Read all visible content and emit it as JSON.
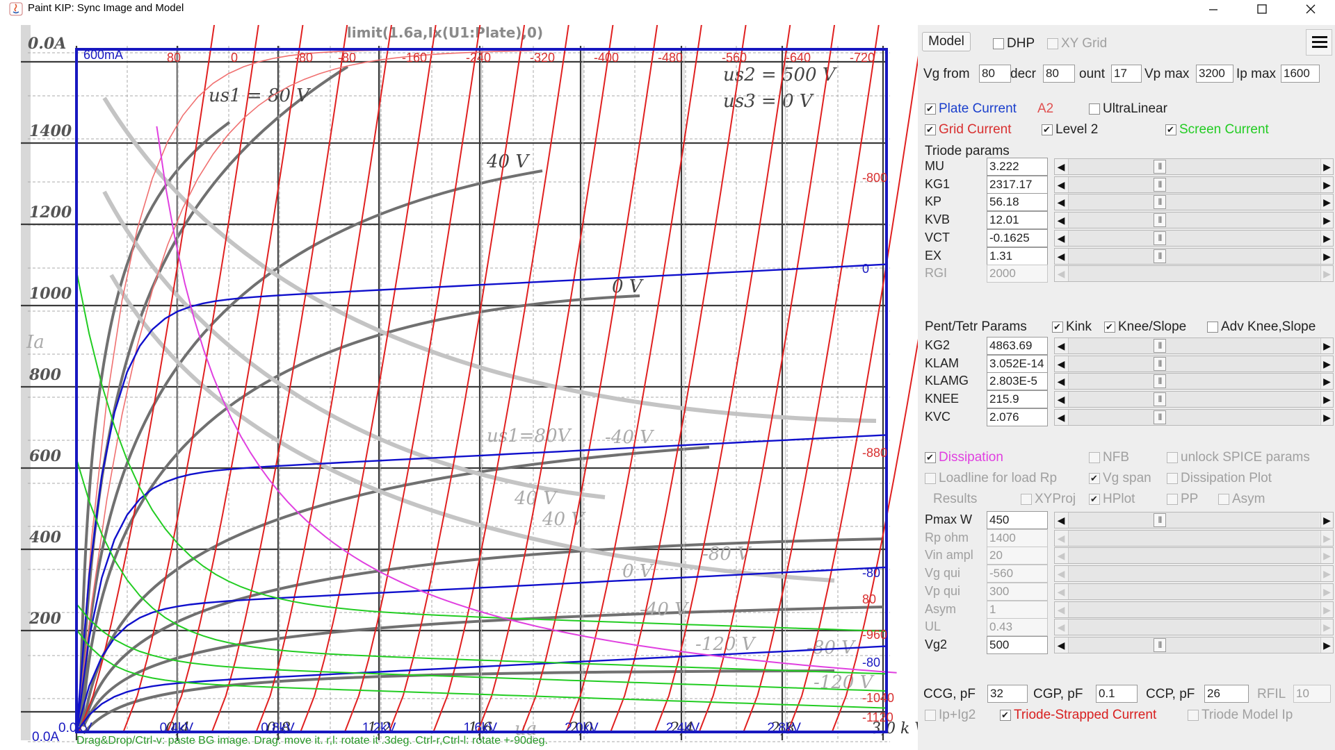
{
  "window": {
    "title": "Paint KIP: Sync Image and Model",
    "buttons": {
      "minimize": "minimize",
      "maximize": "maximize",
      "close": "close"
    }
  },
  "plot": {
    "chart_data": {
      "type": "line",
      "title": "limit(1.6a,Ix(U1:Plate),0)",
      "xlim": [
        0,
        3200
      ],
      "ylim": [
        0,
        1600
      ],
      "ip_scale_label": "600mA",
      "y_top_label": "0.0A",
      "y_zero_label": "0.0A",
      "x_tick_labels": [
        "0.0kV",
        "0.4kV",
        "0.8kV",
        "1.2kV",
        "1.6kV",
        "2.0kV",
        "2.4kV",
        "2.8kV"
      ],
      "bg_y_tick_labels": [
        "1400",
        "1200",
        "1000",
        "800",
        "600",
        "400",
        "200"
      ],
      "bg_x_tick_labels": [
        "0,4",
        "0,8",
        "1,2",
        "1,6",
        "2,0",
        "2,4",
        "2,8",
        "3,0 k V"
      ],
      "top_grid_labels": [
        "80",
        "0",
        "-80",
        "-80",
        "-160",
        "-240",
        "-320",
        "-400",
        "-480",
        "-560",
        "-640",
        "-720"
      ],
      "right_grid_labels": [
        "-800",
        "0",
        "-880",
        "-80",
        "80",
        "-960",
        "-80",
        "-1040",
        "-1120"
      ],
      "bg_annotations": [
        "us2 = 500 V",
        "us3 = 0 V",
        "us1 = 80 V",
        "40 V",
        "0 V",
        "40 V",
        "-40 V",
        "us1=80V",
        "-80 V",
        "0 V",
        "-40 V",
        "-120 V",
        "-80 V",
        "-120 V",
        "40 V",
        "ua",
        "Ia"
      ],
      "series_colors": {
        "plate_current": "#1010cc",
        "grid_current": "#e03030",
        "screen_current": "#22cc22",
        "dissipation": "#e040e0",
        "triode_strapped": "#e02020",
        "background_image": "#555555"
      }
    },
    "status_hint": "Drag&Drop/Ctrl-v: paste BG image. Drag: move it. r,l: rotate it .3deg. Ctrl-r,Ctrl-l: rotate +-90deg."
  },
  "panel": {
    "model_button": "Model",
    "dhp": {
      "label": "DHP",
      "checked": false
    },
    "xy_grid": {
      "label": "XY Grid",
      "checked": false
    },
    "menu_icon": "hamburger-menu",
    "vg_from": {
      "label": "Vg from",
      "value": "80"
    },
    "decr": {
      "label": "decr",
      "value": "80"
    },
    "count": {
      "label": "ount",
      "value": "17"
    },
    "vp_max": {
      "label": "Vp max",
      "value": "3200"
    },
    "ip_max": {
      "label": "Ip max",
      "value": "1600"
    },
    "plate_current": {
      "label": "Plate Current",
      "checked": true,
      "color": "#1a3fcc"
    },
    "a2_label": "A2",
    "ultralinear": {
      "label": "UltraLinear",
      "checked": false
    },
    "grid_current": {
      "label": "Grid Current",
      "checked": true,
      "color": "#d83030"
    },
    "level2": {
      "label": "Level 2",
      "checked": true
    },
    "screen_current": {
      "label": "Screen Current",
      "checked": true,
      "color": "#22cc22"
    },
    "triode_params_header": "Triode params",
    "triode_params": [
      {
        "name": "MU",
        "value": "3.222",
        "enabled": true
      },
      {
        "name": "KG1",
        "value": "2317.17",
        "enabled": true
      },
      {
        "name": "KP",
        "value": "56.18",
        "enabled": true
      },
      {
        "name": "KVB",
        "value": "12.01",
        "enabled": true
      },
      {
        "name": "VCT",
        "value": "-0.1625",
        "enabled": true
      },
      {
        "name": "EX",
        "value": "1.31",
        "enabled": true
      },
      {
        "name": "RGI",
        "value": "2000",
        "enabled": false
      }
    ],
    "pent_header": "Pent/Tetr Params",
    "kink": {
      "label": "Kink",
      "checked": true
    },
    "knee_slope": {
      "label": "Knee/Slope",
      "checked": true
    },
    "adv_knee": {
      "label": "Adv Knee,Slope",
      "checked": false
    },
    "pent_params": [
      {
        "name": "KG2",
        "value": "4863.69",
        "enabled": true
      },
      {
        "name": "KLAM",
        "value": "3.052E-14",
        "enabled": true
      },
      {
        "name": "KLAMG",
        "value": "2.803E-5",
        "enabled": true
      },
      {
        "name": "KNEE",
        "value": "215.9",
        "enabled": true
      },
      {
        "name": "KVC",
        "value": "2.076",
        "enabled": true
      }
    ],
    "dissipation": {
      "label": "Dissipation",
      "checked": true,
      "color": "#e040e0"
    },
    "nfb": {
      "label": "NFB",
      "checked": false
    },
    "unlock_spice": {
      "label": "unlock SPICE params",
      "checked": false
    },
    "loadline": {
      "label": "Loadline for load Rp",
      "checked": false
    },
    "vg_span": {
      "label": "Vg span",
      "checked": true
    },
    "dissipation_plot": {
      "label": "Dissipation Plot",
      "checked": false
    },
    "results_label": "Results",
    "xyproj": {
      "label": "XYProj",
      "checked": false
    },
    "hplot": {
      "label": "HPlot",
      "checked": true
    },
    "pp": {
      "label": "PP",
      "checked": false
    },
    "asym_cb": {
      "label": "Asym",
      "checked": false
    },
    "load_params": [
      {
        "name": "Pmax W",
        "value": "450",
        "enabled": true
      },
      {
        "name": "Rp ohm",
        "value": "1400",
        "enabled": false
      },
      {
        "name": "Vin ampl",
        "value": "20",
        "enabled": false
      },
      {
        "name": "Vg qui",
        "value": "-560",
        "enabled": false
      },
      {
        "name": "Vp qui",
        "value": "300",
        "enabled": false
      },
      {
        "name": "Asym",
        "value": "1",
        "enabled": false
      },
      {
        "name": "UL",
        "value": "0.43",
        "enabled": false
      },
      {
        "name": "Vg2",
        "value": "500",
        "enabled": true
      }
    ],
    "ccg": {
      "label": "CCG, pF",
      "value": "32"
    },
    "cgp": {
      "label": "CGP, pF",
      "value": "0.1"
    },
    "ccp": {
      "label": "CCP, pF",
      "value": "26"
    },
    "rfil": {
      "label": "RFIL",
      "value": "10"
    },
    "ip_ig2": {
      "label": "Ip+Ig2",
      "checked": false
    },
    "triode_strapped": {
      "label": "Triode-Strapped Current",
      "checked": true,
      "color": "#d82020"
    },
    "triode_model_ip": {
      "label": "Triode Model Ip",
      "checked": false
    }
  }
}
